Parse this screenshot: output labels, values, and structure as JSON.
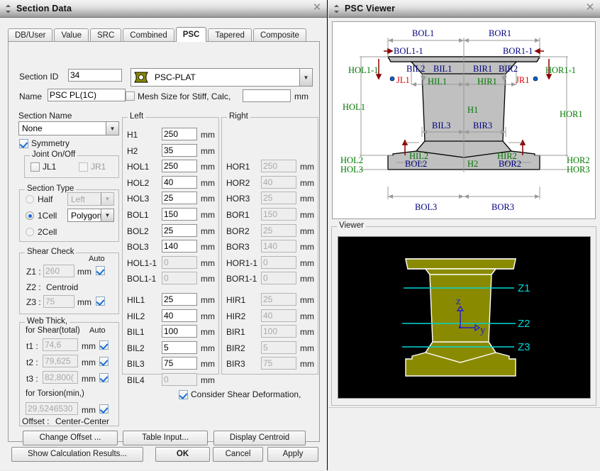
{
  "windows": {
    "left": {
      "title": "Section Data",
      "close_icon": "close-icon",
      "grip_icon": "move-grip-icon"
    },
    "right": {
      "title": "PSC Viewer",
      "close_icon": "close-icon",
      "grip_icon": "move-grip-icon"
    }
  },
  "tabs": [
    {
      "label": "DB/User",
      "active": false
    },
    {
      "label": "Value",
      "active": false
    },
    {
      "label": "SRC",
      "active": false
    },
    {
      "label": "Combined",
      "active": false
    },
    {
      "label": "PSC",
      "active": true
    },
    {
      "label": "Tapered",
      "active": false
    },
    {
      "label": "Composite",
      "active": false
    }
  ],
  "form": {
    "section_id_label": "Section ID",
    "section_id_value": "34",
    "shape_combo_value": "PSC-PLAT",
    "shape_combo_icon": "psc-section-icon",
    "name_label": "Name",
    "name_value": "PSC PL(1C)",
    "mesh_label": "Mesh Size for Stiff, Calc,",
    "mesh_checked": false,
    "mesh_value": "",
    "mesh_unit": "mm",
    "section_name_label": "Section Name",
    "section_name_value": "None",
    "symmetry_label": "Symmetry",
    "symmetry_checked": true
  },
  "joint_group": {
    "title": "Joint On/Off",
    "items": [
      {
        "label": "JL1",
        "checked": false,
        "disabled": false
      },
      {
        "label": "JR1",
        "checked": false,
        "disabled": true
      }
    ]
  },
  "section_type": {
    "title": "Section Type",
    "options": [
      {
        "label": "Half",
        "selected": false
      },
      {
        "label": "1Cell",
        "selected": true
      },
      {
        "label": "2Cell",
        "selected": false
      }
    ],
    "half_combo_value": "Left",
    "half_combo_disabled": true,
    "cell_combo_value": "Polygon",
    "cell_combo_disabled": false
  },
  "shear_check": {
    "title": "Shear Check",
    "auto_label": "Auto",
    "rows": [
      {
        "label": "Z1 :",
        "value": "260",
        "unit": "mm",
        "auto": true,
        "disabled": true
      },
      {
        "label": "Z2 :",
        "value": "Centroid",
        "unit": "",
        "auto": false,
        "text_only": true
      },
      {
        "label": "Z3 :",
        "value": "75",
        "unit": "mm",
        "auto": true,
        "disabled": true
      }
    ]
  },
  "web_thick": {
    "title": "Web Thick,",
    "subtitle": "for Shear(total)",
    "auto_label": "Auto",
    "rows": [
      {
        "label": "t1 :",
        "value": "74,6",
        "unit": "mm",
        "auto": true,
        "disabled": true
      },
      {
        "label": "t2 :",
        "value": "79,625",
        "unit": "mm",
        "auto": true,
        "disabled": true
      },
      {
        "label": "t3 :",
        "value": "82,800(",
        "unit": "mm",
        "auto": true,
        "disabled": true
      }
    ],
    "torsion_label": "for Torsion(min,)",
    "torsion_value": "29,5246530",
    "torsion_unit": "mm",
    "torsion_auto": true
  },
  "left_group": {
    "title": "Left",
    "rows": [
      {
        "label": "H1",
        "value": "250",
        "unit": "mm",
        "disabled": false
      },
      {
        "label": "H2",
        "value": "35",
        "unit": "mm",
        "disabled": false
      },
      {
        "label": "HOL1",
        "value": "250",
        "unit": "mm",
        "disabled": false
      },
      {
        "label": "HOL2",
        "value": "40",
        "unit": "mm",
        "disabled": false
      },
      {
        "label": "HOL3",
        "value": "25",
        "unit": "mm",
        "disabled": false
      },
      {
        "label": "BOL1",
        "value": "150",
        "unit": "mm",
        "disabled": false
      },
      {
        "label": "BOL2",
        "value": "25",
        "unit": "mm",
        "disabled": false
      },
      {
        "label": "BOL3",
        "value": "140",
        "unit": "mm",
        "disabled": false
      },
      {
        "label": "HOL1-1",
        "value": "0",
        "unit": "mm",
        "disabled": true
      },
      {
        "label": "BOL1-1",
        "value": "0",
        "unit": "mm",
        "disabled": true
      },
      {
        "label": "HIL1",
        "value": "25",
        "unit": "mm",
        "disabled": false
      },
      {
        "label": "HIL2",
        "value": "40",
        "unit": "mm",
        "disabled": false
      },
      {
        "label": "BIL1",
        "value": "100",
        "unit": "mm",
        "disabled": false
      },
      {
        "label": "BIL2",
        "value": "5",
        "unit": "mm",
        "disabled": false
      },
      {
        "label": "BIL3",
        "value": "75",
        "unit": "mm",
        "disabled": false
      },
      {
        "label": "BIL4",
        "value": "0",
        "unit": "mm",
        "disabled": true
      }
    ]
  },
  "right_group": {
    "title": "Right",
    "rows": [
      {
        "label": "",
        "value": "",
        "unit": "",
        "blank": true
      },
      {
        "label": "",
        "value": "",
        "unit": "",
        "blank": true
      },
      {
        "label": "HOR1",
        "value": "250",
        "unit": "mm",
        "disabled": true
      },
      {
        "label": "HOR2",
        "value": "40",
        "unit": "mm",
        "disabled": true
      },
      {
        "label": "HOR3",
        "value": "25",
        "unit": "mm",
        "disabled": true
      },
      {
        "label": "BOR1",
        "value": "150",
        "unit": "mm",
        "disabled": true
      },
      {
        "label": "BOR2",
        "value": "25",
        "unit": "mm",
        "disabled": true
      },
      {
        "label": "BOR3",
        "value": "140",
        "unit": "mm",
        "disabled": true
      },
      {
        "label": "HOR1-1",
        "value": "0",
        "unit": "mm",
        "disabled": true
      },
      {
        "label": "BOR1-1",
        "value": "0",
        "unit": "mm",
        "disabled": true
      },
      {
        "label": "HIR1",
        "value": "25",
        "unit": "mm",
        "disabled": true
      },
      {
        "label": "HIR2",
        "value": "40",
        "unit": "mm",
        "disabled": true
      },
      {
        "label": "BIR1",
        "value": "100",
        "unit": "mm",
        "disabled": true
      },
      {
        "label": "BIR2",
        "value": "5",
        "unit": "mm",
        "disabled": true
      },
      {
        "label": "BIR3",
        "value": "75",
        "unit": "mm",
        "disabled": true
      },
      {
        "label": "",
        "value": "",
        "unit": "",
        "blank": true
      }
    ]
  },
  "shear_deformation": {
    "label": "Consider Shear Deformation,",
    "checked": true
  },
  "offset": {
    "label": "Offset :",
    "value": "Center-Center",
    "change_offset_button": "Change Offset ...",
    "table_input_button": "Table Input...",
    "display_centroid_button": "Display Centroid"
  },
  "footer": {
    "show_calc_button": "Show Calculation Results...",
    "ok_button": "OK",
    "cancel_button": "Cancel",
    "apply_button": "Apply"
  },
  "viewer": {
    "group_title": "Viewer",
    "axis_z": "z",
    "axis_y": "y",
    "shear_lines": [
      "Z1",
      "Z2",
      "Z3"
    ],
    "shape_color": "#8a8a00",
    "background": "#000000",
    "line_color": "#00d5d5"
  },
  "diagram": {
    "dim_labels_blue": [
      "BOL1",
      "BOR1",
      "BOL1-1",
      "BOR1-1",
      "BIL2",
      "BIL1",
      "BIR1",
      "BIR2",
      "BIL3",
      "BIR3",
      "BOL2",
      "BOR2",
      "BOL3",
      "BOR3"
    ],
    "dim_labels_green": [
      "HOL1-1",
      "HOR1-1",
      "HOL1",
      "HOR1",
      "HIL1",
      "HIR1",
      "H1",
      "HIL2",
      "HIR2",
      "HOL2",
      "HOL3",
      "HOR2",
      "HOR3",
      "H2"
    ],
    "joint_labels_red": [
      "JL1",
      "JR1"
    ],
    "colors": {
      "blue": "#00007f",
      "green": "#007700",
      "red": "#e00000",
      "fill": "#c0c0c0"
    }
  }
}
